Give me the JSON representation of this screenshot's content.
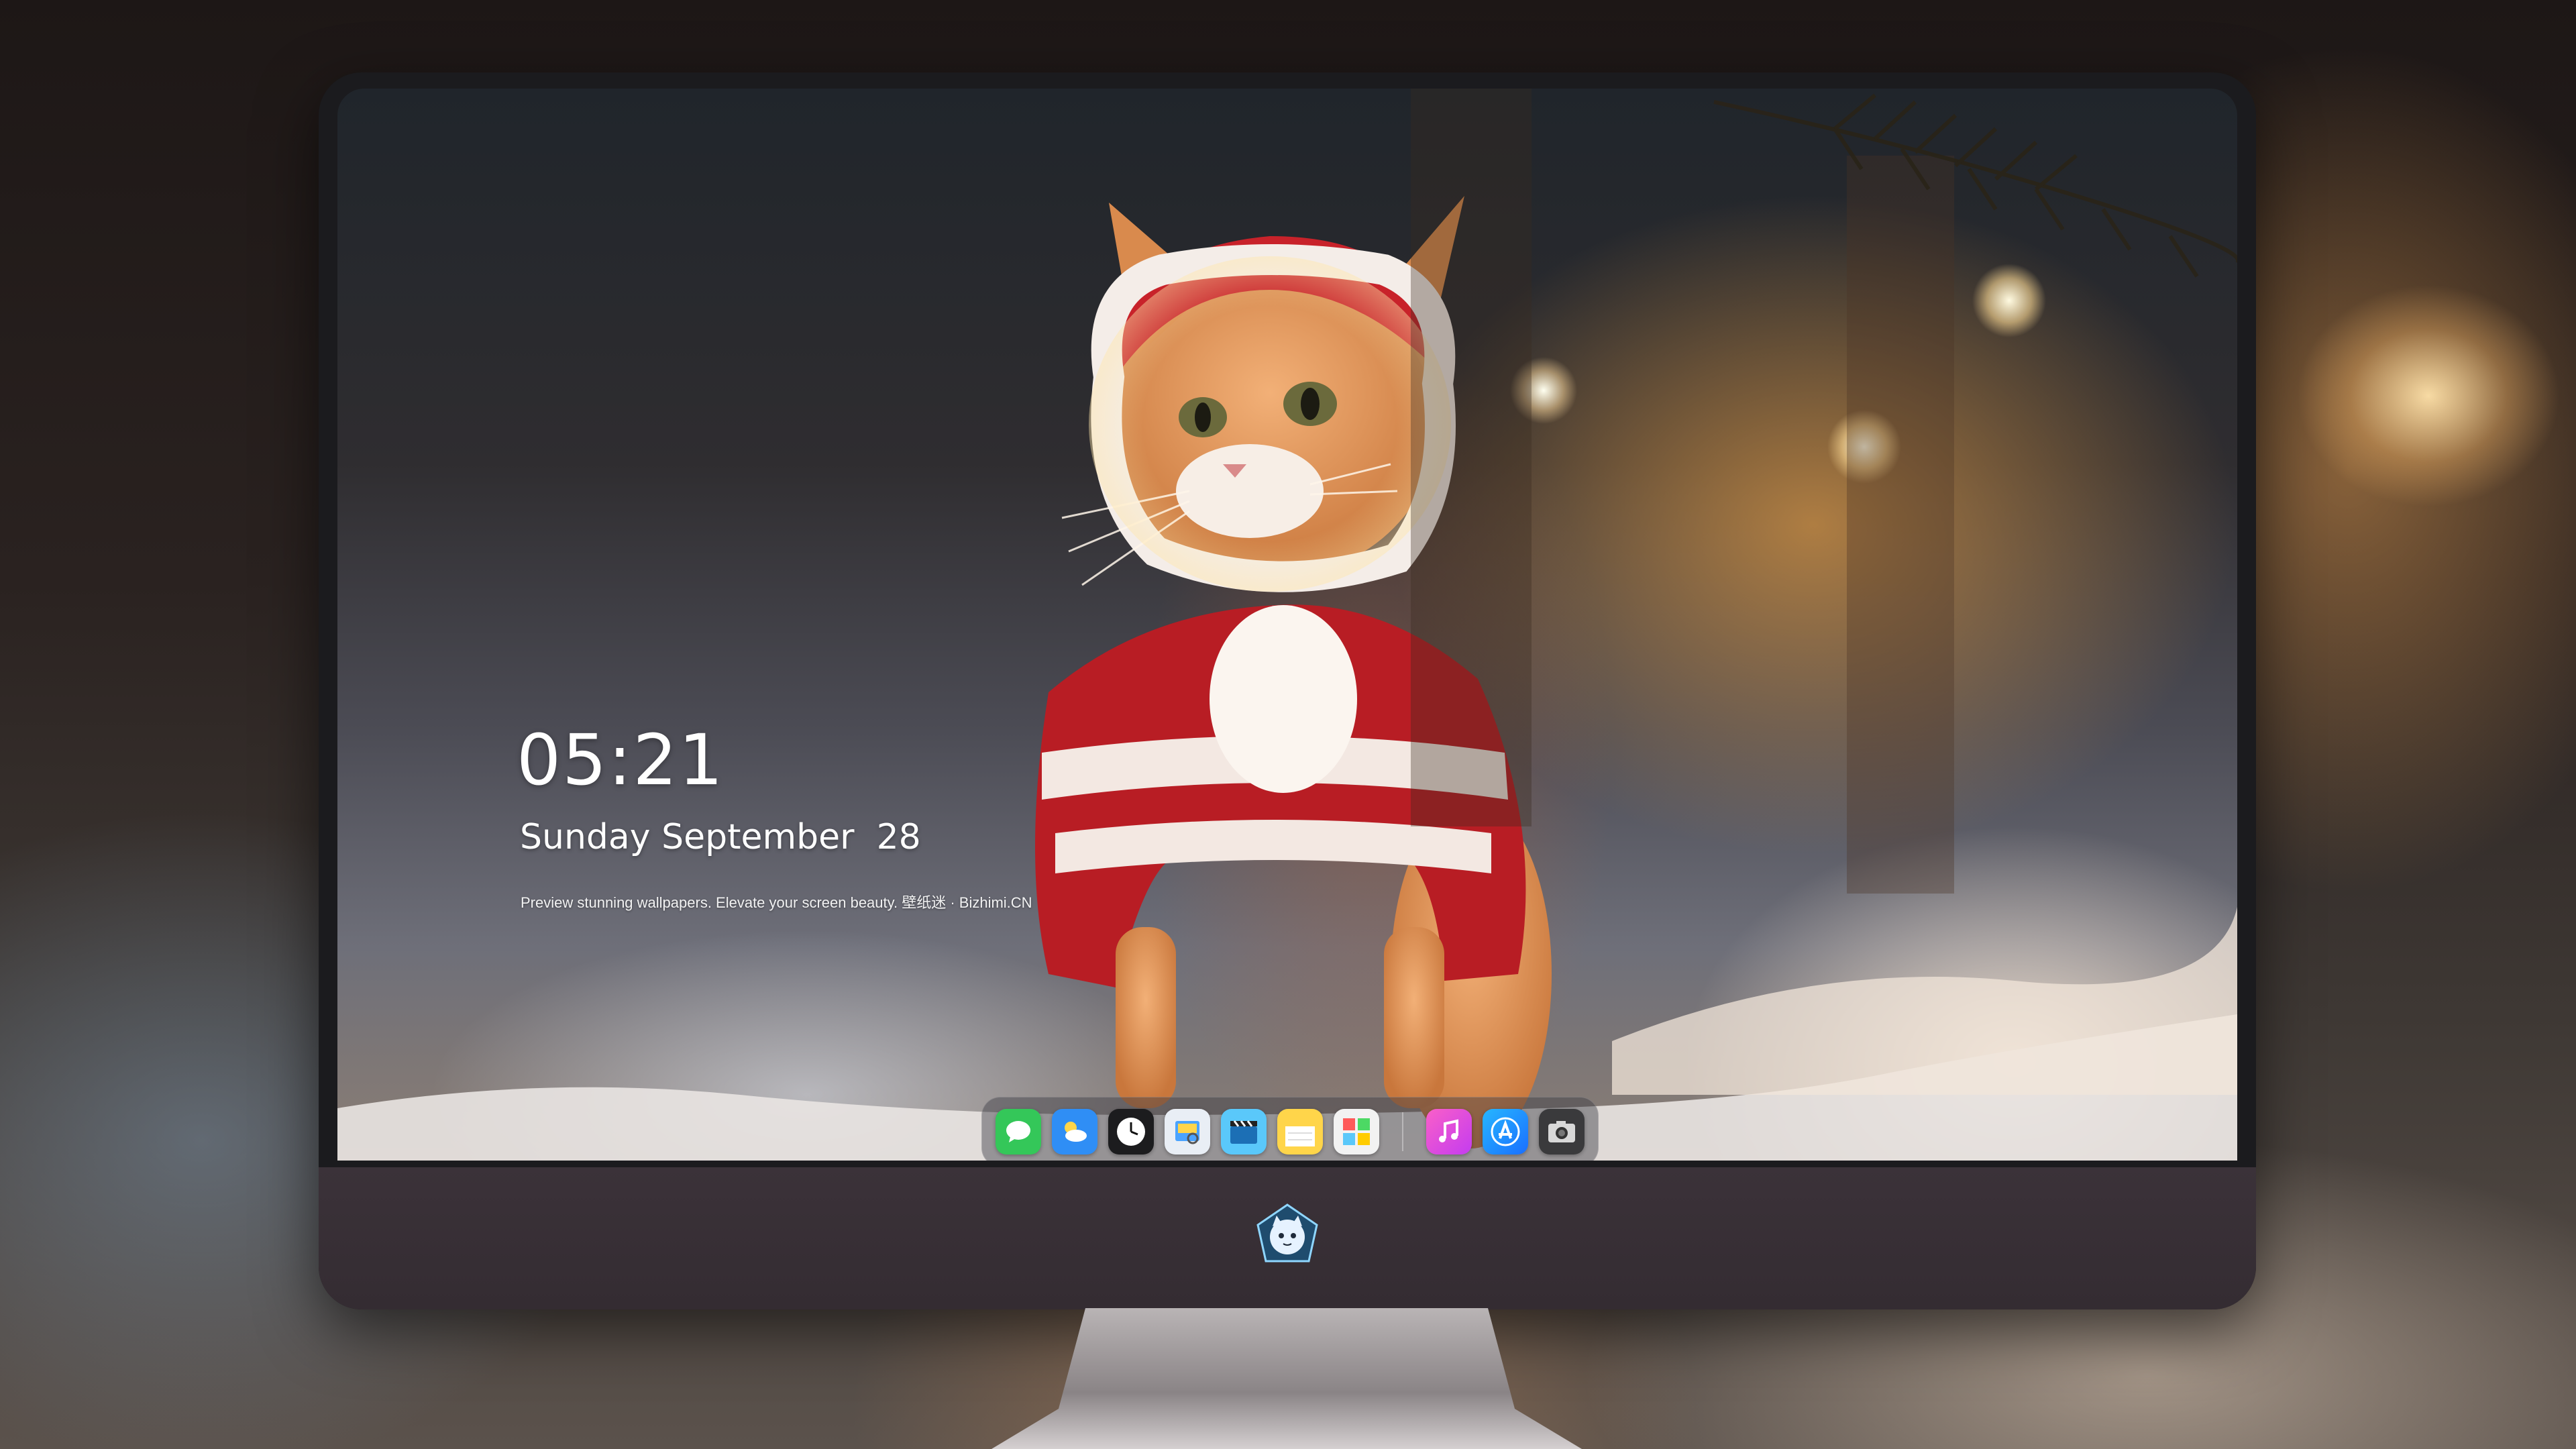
{
  "lock_screen": {
    "time": "05:21",
    "date": "Sunday September  28",
    "caption": "Preview stunning wallpapers. Elevate your screen beauty. 壁纸迷 · Bizhimi.CN"
  },
  "dock": {
    "apps": [
      {
        "icon": "messages-icon",
        "color": "#34c759"
      },
      {
        "icon": "weather-icon",
        "color": "#2f8ef5"
      },
      {
        "icon": "clock-icon",
        "color": "#1c1c1e"
      },
      {
        "icon": "preview-icon",
        "color": "#e9eef5"
      },
      {
        "icon": "clips-icon",
        "color": "#5ac8fa"
      },
      {
        "icon": "notes-icon",
        "color": "#ffd54a"
      },
      {
        "icon": "photo-booth-icon",
        "color": "#f2f2f2"
      }
    ],
    "apps_right": [
      {
        "icon": "music-icon",
        "color": "#f74bd6"
      },
      {
        "icon": "app-store-icon",
        "color": "#1a8cff"
      },
      {
        "icon": "camera-icon",
        "color": "#3a3a3c"
      }
    ]
  },
  "monitor": {
    "chin_logo": "cat-mascot-logo-icon"
  }
}
